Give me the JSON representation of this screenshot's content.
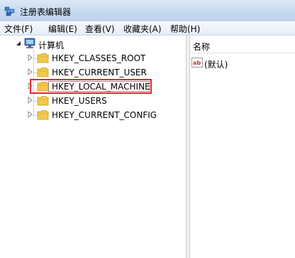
{
  "window": {
    "title": "注册表编辑器",
    "icon": "regedit-icon"
  },
  "menu": [
    "文件(F)",
    "编辑(E)",
    "查看(V)",
    "收藏夹(A)",
    "帮助(H)"
  ],
  "tree": {
    "root": "计算机",
    "keys": [
      "HKEY_CLASSES_ROOT",
      "HKEY_CURRENT_USER",
      "HKEY_LOCAL_MACHINE",
      "HKEY_USERS",
      "HKEY_CURRENT_CONFIG"
    ],
    "selected": "HKEY_LOCAL_MACHINE"
  },
  "list": {
    "column_name": "名称",
    "values": [
      {
        "icon": "ab-string-icon",
        "name": "(默认)"
      }
    ]
  },
  "colors": {
    "highlight_border": "#e5262f",
    "folder": "#f2c94c"
  }
}
